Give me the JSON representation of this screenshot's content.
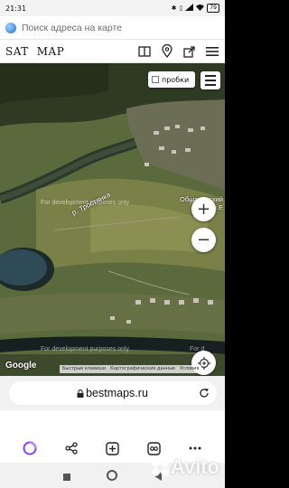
{
  "status_bar": {
    "time": "21:31",
    "icons": [
      "camera-icon",
      "bluetooth-icon",
      "vibrate-icon",
      "signal-icon",
      "wifi-icon"
    ],
    "battery": "79"
  },
  "search": {
    "placeholder": "Поиск адреса на карте"
  },
  "header": {
    "brand_left": "SAT",
    "brand_right": "MAP",
    "actions": [
      "book-icon",
      "location-pin-icon",
      "share-icon",
      "menu-icon"
    ]
  },
  "map": {
    "traffic_label": "пробки",
    "river_label": "р. Тростянка",
    "village_label_line1": "Обшаровский",
    "village_label_line2": "Имени Е",
    "dev_watermark": "For development purposes only",
    "dev_watermark_partial": "For d",
    "zoom_in": "+",
    "zoom_out": "−",
    "google": "Google",
    "attribution": [
      "Быстрые клавиши",
      "Картографические данные",
      "Условия"
    ]
  },
  "browser": {
    "url": "bestmaps.ru"
  },
  "toolbar": {
    "items": [
      "alice-icon",
      "share-icon",
      "new-tab-icon",
      "tabs-icon",
      "more-icon"
    ]
  },
  "watermark": {
    "avito": "Avito"
  },
  "colors": {
    "brand_blue": "#1e6fd0",
    "alice_purple": "#8a3ffc"
  }
}
